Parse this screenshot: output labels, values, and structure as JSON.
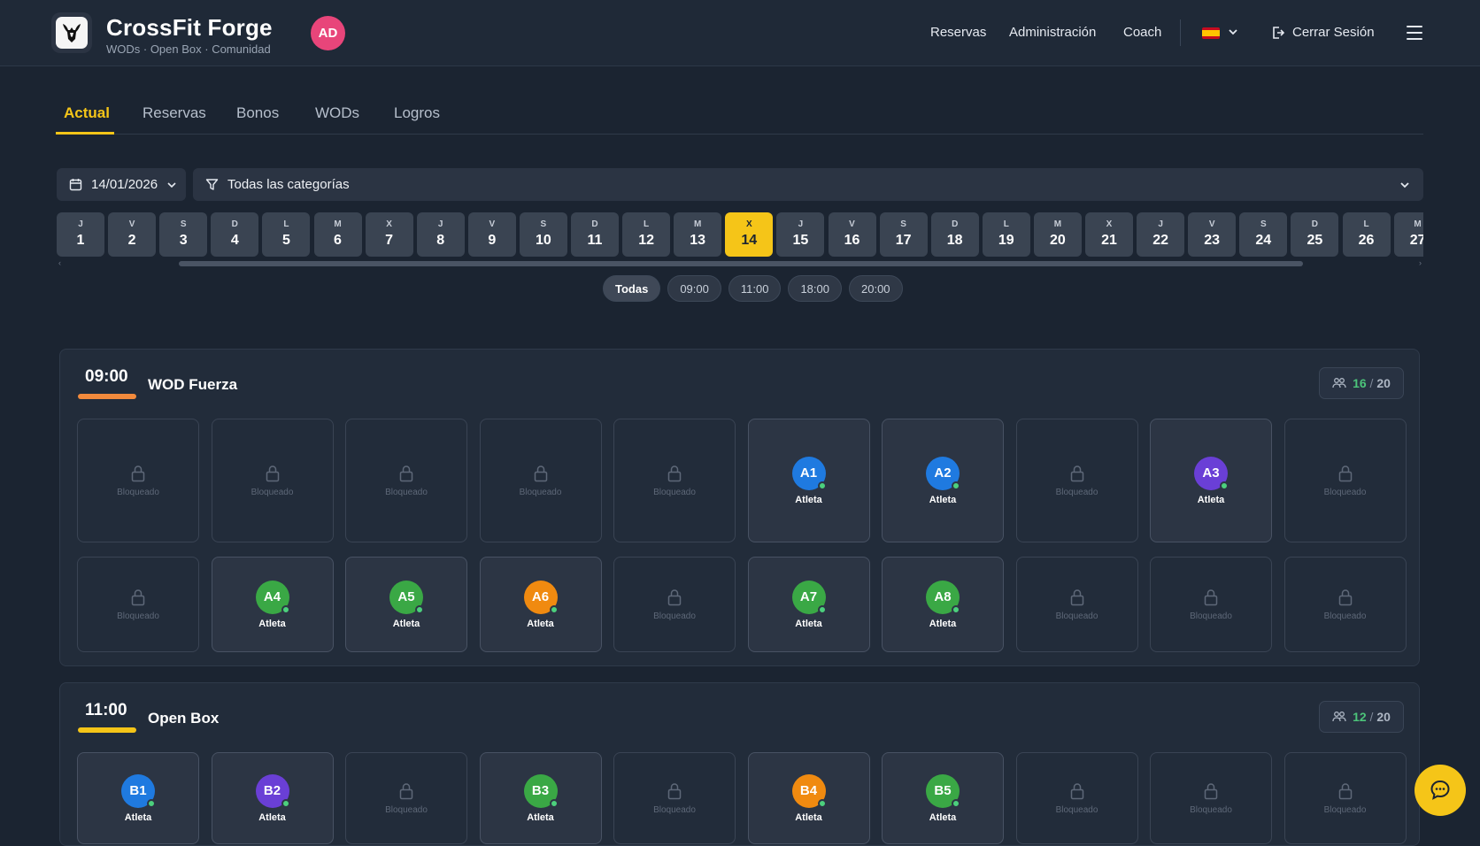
{
  "header": {
    "brand_title": "CrossFit Forge",
    "brand_subtitle": "WODs · Open Box · Comunidad",
    "avatar_initials": "AD",
    "nav": [
      "Reservas",
      "Administración",
      "Coach"
    ],
    "logout_label": "Cerrar Sesión"
  },
  "tabs": [
    "Actual",
    "Reservas",
    "Bonos",
    "WODs",
    "Logros"
  ],
  "filters": {
    "date": "14/01/2026",
    "category": "Todas las categorías"
  },
  "days": [
    {
      "l": "J",
      "n": "1"
    },
    {
      "l": "V",
      "n": "2"
    },
    {
      "l": "S",
      "n": "3"
    },
    {
      "l": "D",
      "n": "4"
    },
    {
      "l": "L",
      "n": "5"
    },
    {
      "l": "M",
      "n": "6"
    },
    {
      "l": "X",
      "n": "7"
    },
    {
      "l": "J",
      "n": "8"
    },
    {
      "l": "V",
      "n": "9"
    },
    {
      "l": "S",
      "n": "10"
    },
    {
      "l": "D",
      "n": "11"
    },
    {
      "l": "L",
      "n": "12"
    },
    {
      "l": "M",
      "n": "13"
    },
    {
      "l": "X",
      "n": "14"
    },
    {
      "l": "J",
      "n": "15"
    },
    {
      "l": "V",
      "n": "16"
    },
    {
      "l": "S",
      "n": "17"
    },
    {
      "l": "D",
      "n": "18"
    },
    {
      "l": "L",
      "n": "19"
    },
    {
      "l": "M",
      "n": "20"
    },
    {
      "l": "X",
      "n": "21"
    },
    {
      "l": "J",
      "n": "22"
    },
    {
      "l": "V",
      "n": "23"
    },
    {
      "l": "S",
      "n": "24"
    },
    {
      "l": "D",
      "n": "25"
    },
    {
      "l": "L",
      "n": "26"
    },
    {
      "l": "M",
      "n": "27"
    }
  ],
  "selected_day": "14",
  "time_chips": [
    "Todas",
    "09:00",
    "11:00",
    "18:00",
    "20:00"
  ],
  "locked_label": "Bloqueado",
  "athlete_label": "Atleta",
  "sessions": [
    {
      "time": "09:00",
      "name": "WOD Fuerza",
      "bar_color": "#f28a3c",
      "capacity_current": "16",
      "capacity_total": "20",
      "slots": [
        null,
        null,
        null,
        null,
        null,
        {
          "code": "A1",
          "color": "#1f7ae0"
        },
        {
          "code": "A2",
          "color": "#1f7ae0"
        },
        null,
        {
          "code": "A3",
          "color": "#6a3fd6"
        },
        null,
        null,
        {
          "code": "A4",
          "color": "#3aa845"
        },
        {
          "code": "A5",
          "color": "#3aa845"
        },
        {
          "code": "A6",
          "color": "#f08a10"
        },
        null,
        {
          "code": "A7",
          "color": "#3aa845"
        },
        {
          "code": "A8",
          "color": "#3aa845"
        },
        null,
        null,
        null
      ]
    },
    {
      "time": "11:00",
      "name": "Open Box",
      "bar_color": "#f5c518",
      "capacity_current": "12",
      "capacity_total": "20",
      "slots": [
        {
          "code": "B1",
          "color": "#1f7ae0"
        },
        {
          "code": "B2",
          "color": "#6a3fd6"
        },
        null,
        {
          "code": "B3",
          "color": "#3aa845"
        },
        null,
        {
          "code": "B4",
          "color": "#f08a10"
        },
        {
          "code": "B5",
          "color": "#3aa845"
        },
        null,
        null,
        null
      ]
    }
  ]
}
